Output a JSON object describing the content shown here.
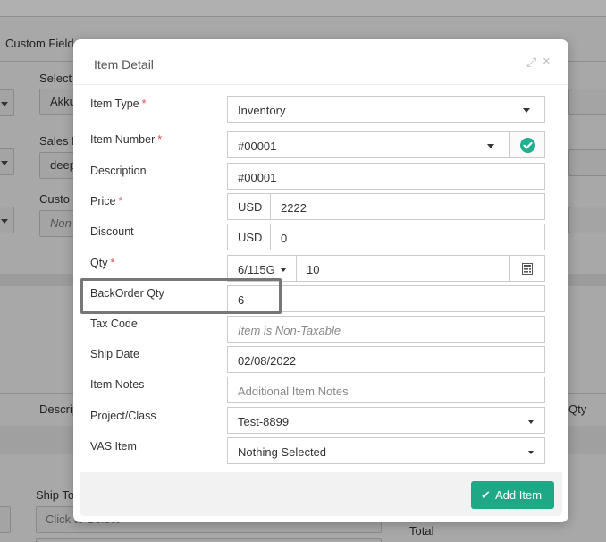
{
  "background": {
    "tab_custom_fields": "Custom Fields",
    "select_label": "Select C",
    "select_value": "Akku",
    "sales_rep_label": "Sales R",
    "sales_rep_value": "deep",
    "custom_label": "Custo",
    "custom_value": "Non",
    "table_col_description": "Descrip",
    "table_col_qty": "Qty",
    "ship_to_label": "Ship To",
    "ship_to_placeholder": "Click to Select",
    "total_label": "Total"
  },
  "modal": {
    "title": "Item Detail",
    "expand_icon": "⤢",
    "close_icon": "×",
    "fields": {
      "item_type": {
        "label": "Item Type",
        "required": "*",
        "value": "Inventory"
      },
      "item_number": {
        "label": "Item Number",
        "required": "*",
        "value": "#00001"
      },
      "description": {
        "label": "Description",
        "value": "#00001"
      },
      "price": {
        "label": "Price",
        "required": "*",
        "currency": "USD",
        "value": "2222"
      },
      "discount": {
        "label": "Discount",
        "currency": "USD",
        "value": "0"
      },
      "qty": {
        "label": "Qty",
        "required": "*",
        "unit": "6/115G",
        "value": "10"
      },
      "backorder_qty": {
        "label": "BackOrder Qty",
        "value": "6"
      },
      "tax_code": {
        "label": "Tax Code",
        "placeholder": "Item is Non-Taxable"
      },
      "ship_date": {
        "label": "Ship Date",
        "value": "02/08/2022"
      },
      "item_notes": {
        "label": "Item Notes",
        "placeholder": "Additional Item Notes"
      },
      "project_class": {
        "label": "Project/Class",
        "value": "Test-8899"
      },
      "vas_item": {
        "label": "VAS Item",
        "value": "Nothing Selected"
      }
    },
    "add_button": {
      "label": "Add Item",
      "icon": "✔"
    }
  },
  "colors": {
    "accent": "#1fa886",
    "required": "#d9534f",
    "check": "#1fae8e"
  }
}
